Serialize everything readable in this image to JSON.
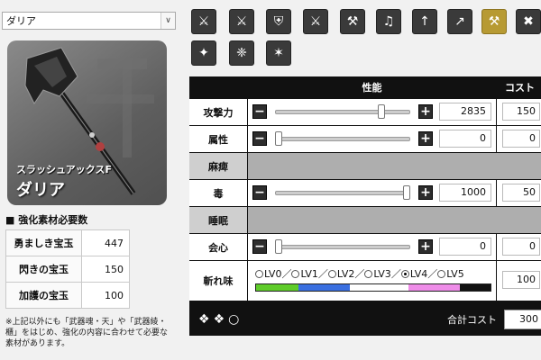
{
  "weapon_select": {
    "value": "ダリア"
  },
  "weapon": {
    "class": "スラッシュアックスF",
    "name": "ダリア"
  },
  "materials": {
    "title": "■ 強化素材必要数",
    "items": [
      {
        "name": "勇ましき宝玉",
        "value": "447"
      },
      {
        "name": "閃きの宝玉",
        "value": "150"
      },
      {
        "name": "加護の宝玉",
        "value": "100"
      }
    ],
    "note": "※上記以外にも「武器魂・天」や「武器綾・櫃」をはじめ、強化の内容に合わせて必要な素材があります。"
  },
  "weapon_types": [
    {
      "icon": "great-sword-icon"
    },
    {
      "icon": "long-sword-icon"
    },
    {
      "icon": "sword-shield-icon"
    },
    {
      "icon": "dual-blades-icon"
    },
    {
      "icon": "hammer-icon"
    },
    {
      "icon": "hunting-horn-icon"
    },
    {
      "icon": "lance-icon"
    },
    {
      "icon": "gunlance-icon"
    },
    {
      "icon": "switch-axe-icon"
    },
    {
      "icon": "tonfa-icon"
    },
    {
      "icon": "insect-glaive-icon"
    },
    {
      "icon": "magnet-spike-icon"
    },
    {
      "icon": "bowgun-icon"
    }
  ],
  "table": {
    "header_performance": "性能",
    "header_cost": "コスト",
    "rows": [
      {
        "label": "攻撃力",
        "value": "2835",
        "cost": "150",
        "level": 0.8
      },
      {
        "label": "属性",
        "value": "0",
        "cost": "0",
        "level": 0
      },
      {
        "label": "麻痺"
      },
      {
        "label": "毒",
        "value": "1000",
        "cost": "50",
        "level": 1
      },
      {
        "label": "睡眠"
      },
      {
        "label": "会心",
        "value": "0",
        "cost": "0",
        "level": 0
      }
    ],
    "sharpness": {
      "label": "斬れ味",
      "levels": [
        "LV0",
        "LV1",
        "LV2",
        "LV3",
        "LV4",
        "LV5"
      ],
      "selected": "LV4",
      "cost": "100",
      "colors": [
        "#5fcc2a",
        "#3a6fe0",
        "#ffffff",
        "#ee8ce8",
        "#111111"
      ]
    },
    "total_label": "合計コスト",
    "total_value": "300"
  }
}
